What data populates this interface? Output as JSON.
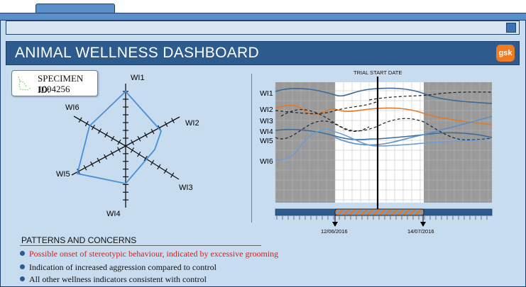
{
  "window": {
    "title": "ANIMAL WELLNESS DASHBOARD",
    "logo_text": "gsk"
  },
  "specimen": {
    "label": "SPECIMEN ID:",
    "value": "1004256"
  },
  "radar": {
    "axes": [
      "WI1",
      "WI2",
      "WI3",
      "WI4",
      "WI5",
      "WI6"
    ]
  },
  "timeline": {
    "trial_label": "TRIAL START DATE",
    "date_start": "12/06/2016",
    "date_end": "14/07/2016",
    "series_labels": [
      "WI1",
      "WI2",
      "WI3",
      "WI4",
      "WI5",
      "WI6"
    ]
  },
  "patterns": {
    "title": "PATTERNS AND CONCERNS",
    "items": [
      {
        "text": "Possible onset of stereotypic behaviour, indicated by excessive grooming",
        "alert": true
      },
      {
        "text": "Indication of increased aggression compared to control",
        "alert": false
      },
      {
        "text": "All other wellness indicators consistent with control",
        "alert": false
      }
    ]
  },
  "colors": {
    "accent": "#2d5b8d",
    "alert": "#d22020",
    "orange": "#e07a2b",
    "panel": "#c8dcf0"
  }
}
